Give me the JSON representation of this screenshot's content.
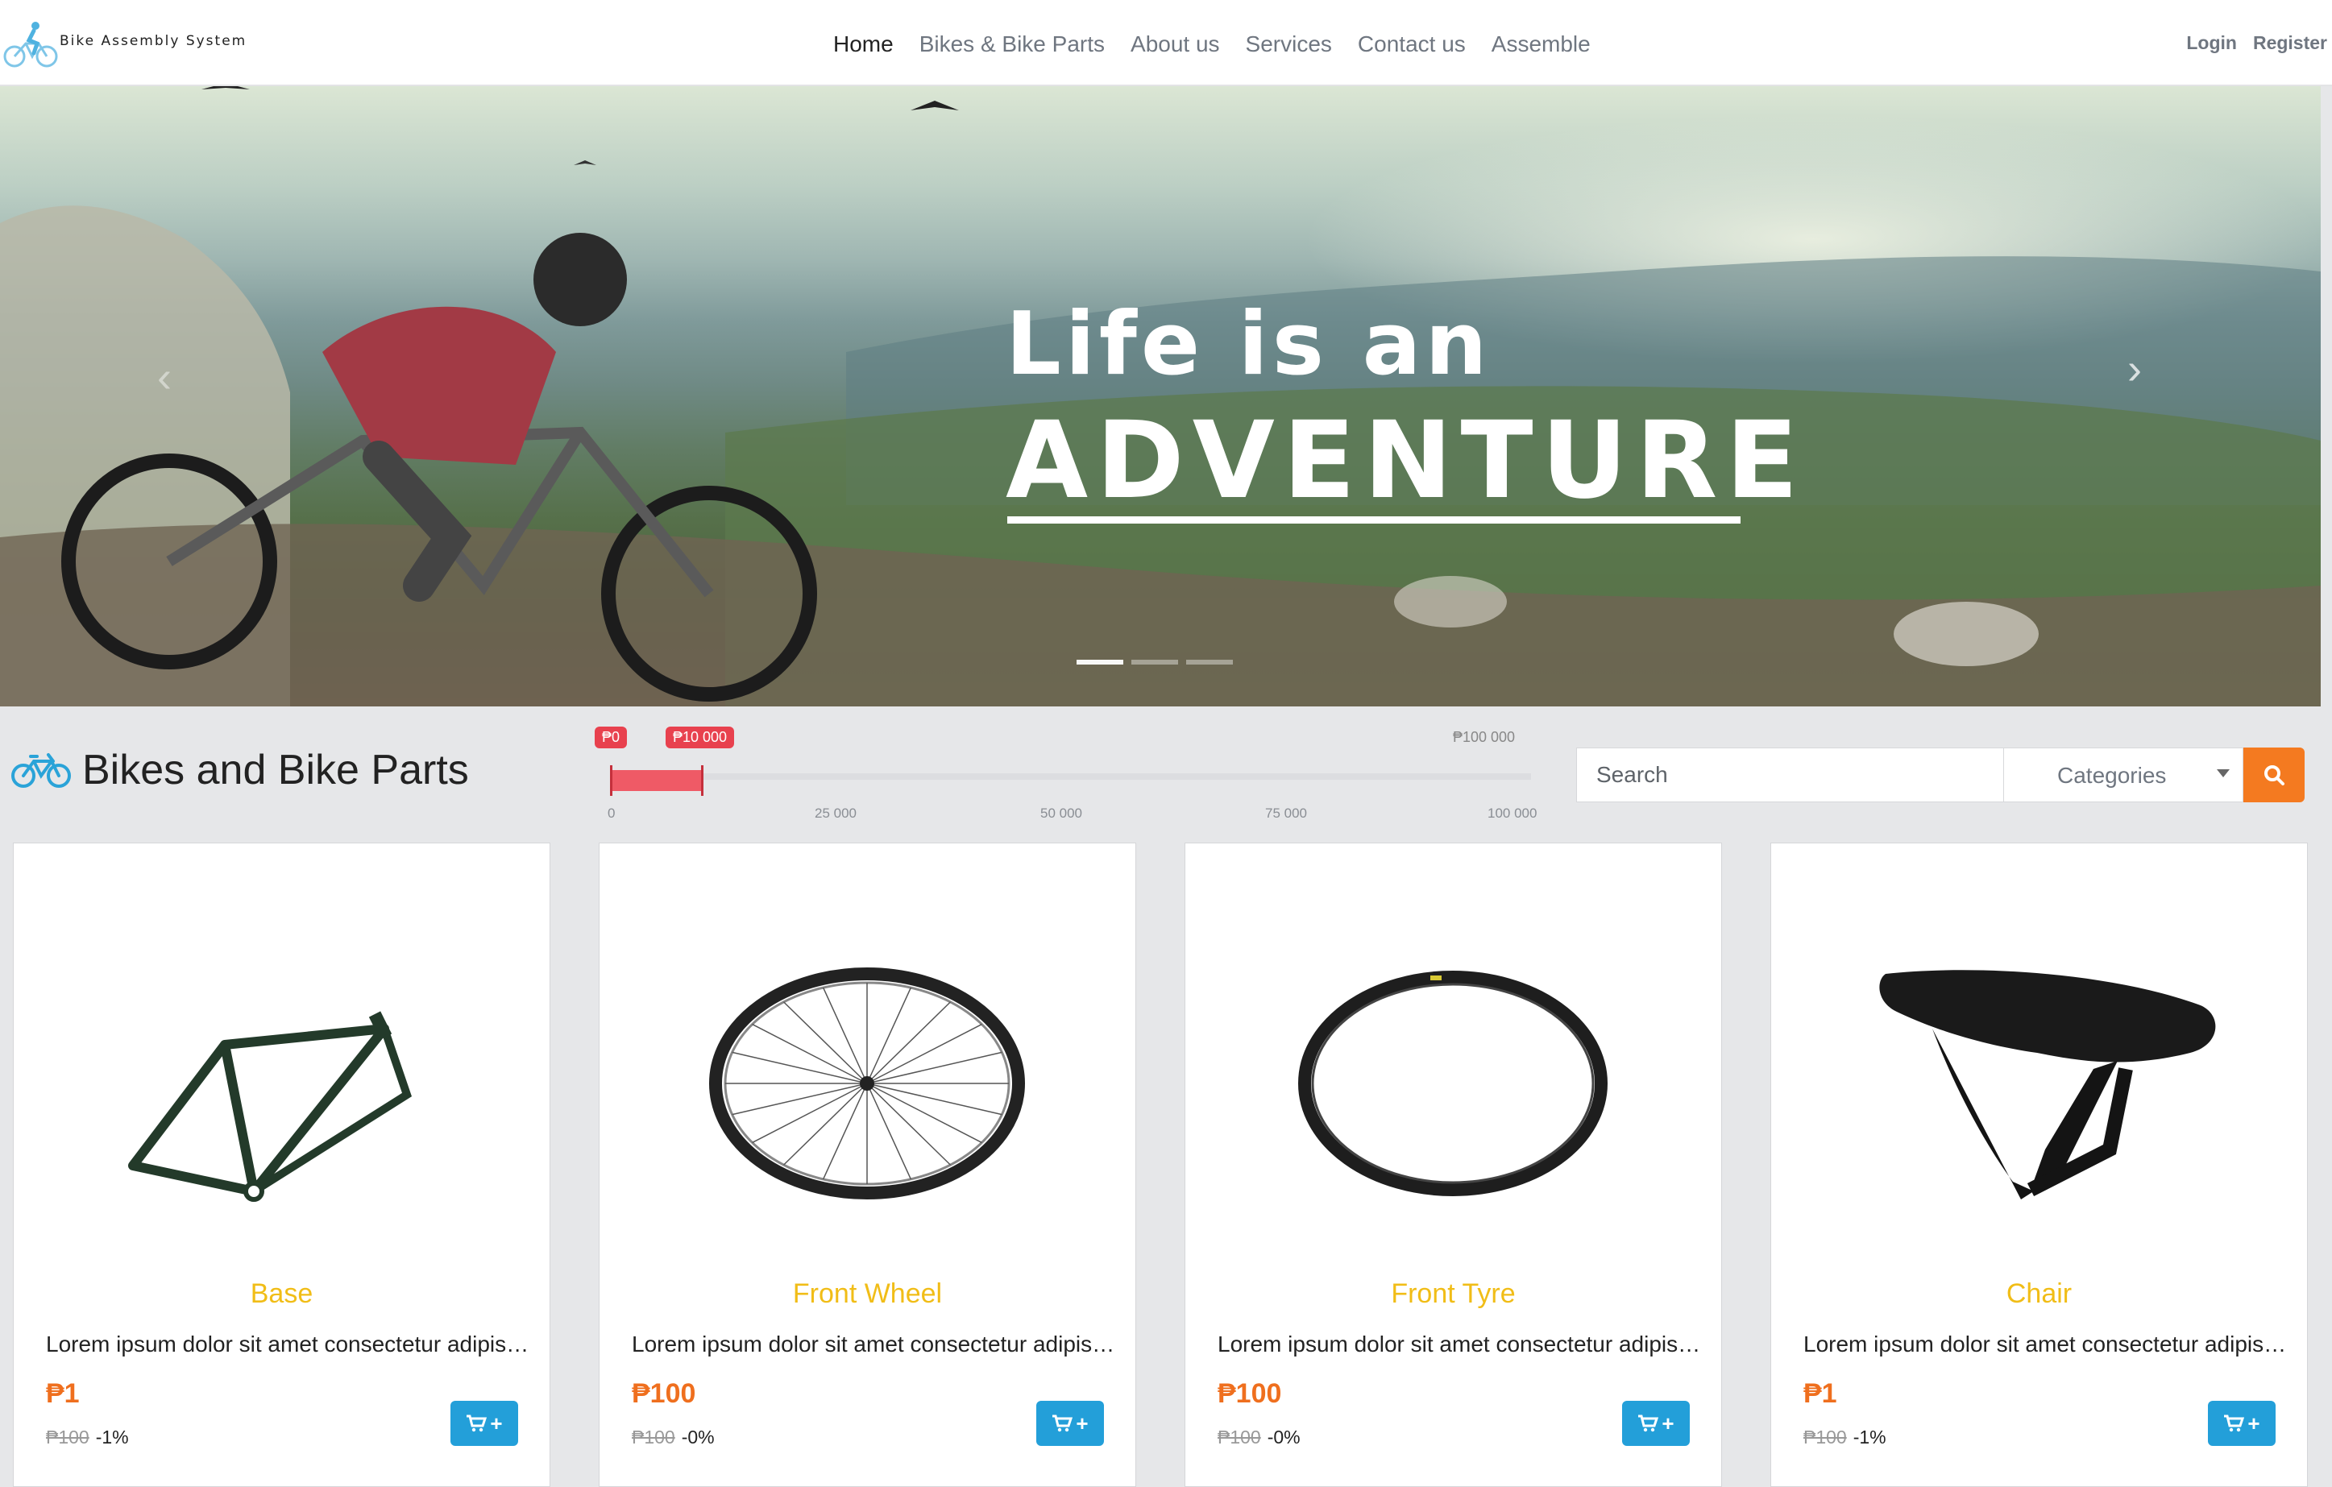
{
  "brand": {
    "name": "Bike Assembly System"
  },
  "nav": {
    "items": [
      {
        "label": "Home",
        "active": true
      },
      {
        "label": "Bikes & Bike Parts",
        "active": false
      },
      {
        "label": "About us",
        "active": false
      },
      {
        "label": "Services",
        "active": false
      },
      {
        "label": "Contact us",
        "active": false
      },
      {
        "label": "Assemble",
        "active": false
      }
    ],
    "login": "Login",
    "register": "Register"
  },
  "hero": {
    "line1": "Life is an",
    "line2": "ADVENTURE",
    "prev_glyph": "‹",
    "next_glyph": "›",
    "slide_count": 3,
    "active_slide": 0
  },
  "catalog": {
    "title": "Bikes and Bike Parts",
    "price_filter": {
      "min_label": "₱0",
      "max_selected_label": "₱10 000",
      "max_label": "₱100 000",
      "min": 0,
      "max": 100000,
      "selected": [
        0,
        10000
      ],
      "ticks": [
        "0",
        "25 000",
        "50 000",
        "75 000",
        "100 000"
      ]
    },
    "search": {
      "placeholder": "Search"
    },
    "category_select": {
      "selected": "Categories"
    },
    "products": [
      {
        "name": "Base",
        "description": "Lorem ipsum dolor sit amet consectetur adipisicing elit",
        "price": "₱1",
        "old_price": "₱100",
        "discount": "-1%",
        "image_icon": "bike-frame-icon",
        "cart_plus": "+"
      },
      {
        "name": "Front Wheel",
        "description": "Lorem ipsum dolor sit amet consectetur adipisicing elit",
        "price": "₱100",
        "old_price": "₱100",
        "discount": "-0%",
        "image_icon": "wheel-icon",
        "cart_plus": "+"
      },
      {
        "name": "Front Tyre",
        "description": "Lorem ipsum dolor sit amet consectetur adipisicing elit",
        "price": "₱100",
        "old_price": "₱100",
        "discount": "-0%",
        "image_icon": "tyre-icon",
        "cart_plus": "+"
      },
      {
        "name": "Chair",
        "description": "Lorem ipsum dolor sit amet consectetur adipisicing elit",
        "price": "₱1",
        "old_price": "₱100",
        "discount": "-1%",
        "image_icon": "saddle-icon",
        "cart_plus": "+"
      }
    ]
  },
  "colors": {
    "accent_orange": "#f47a20",
    "price_orange": "#ef6f1e",
    "title_yellow": "#f1bd17",
    "cart_blue": "#239fd9",
    "slider_red": "#e8414e",
    "icon_blue": "#2aa3d8"
  }
}
